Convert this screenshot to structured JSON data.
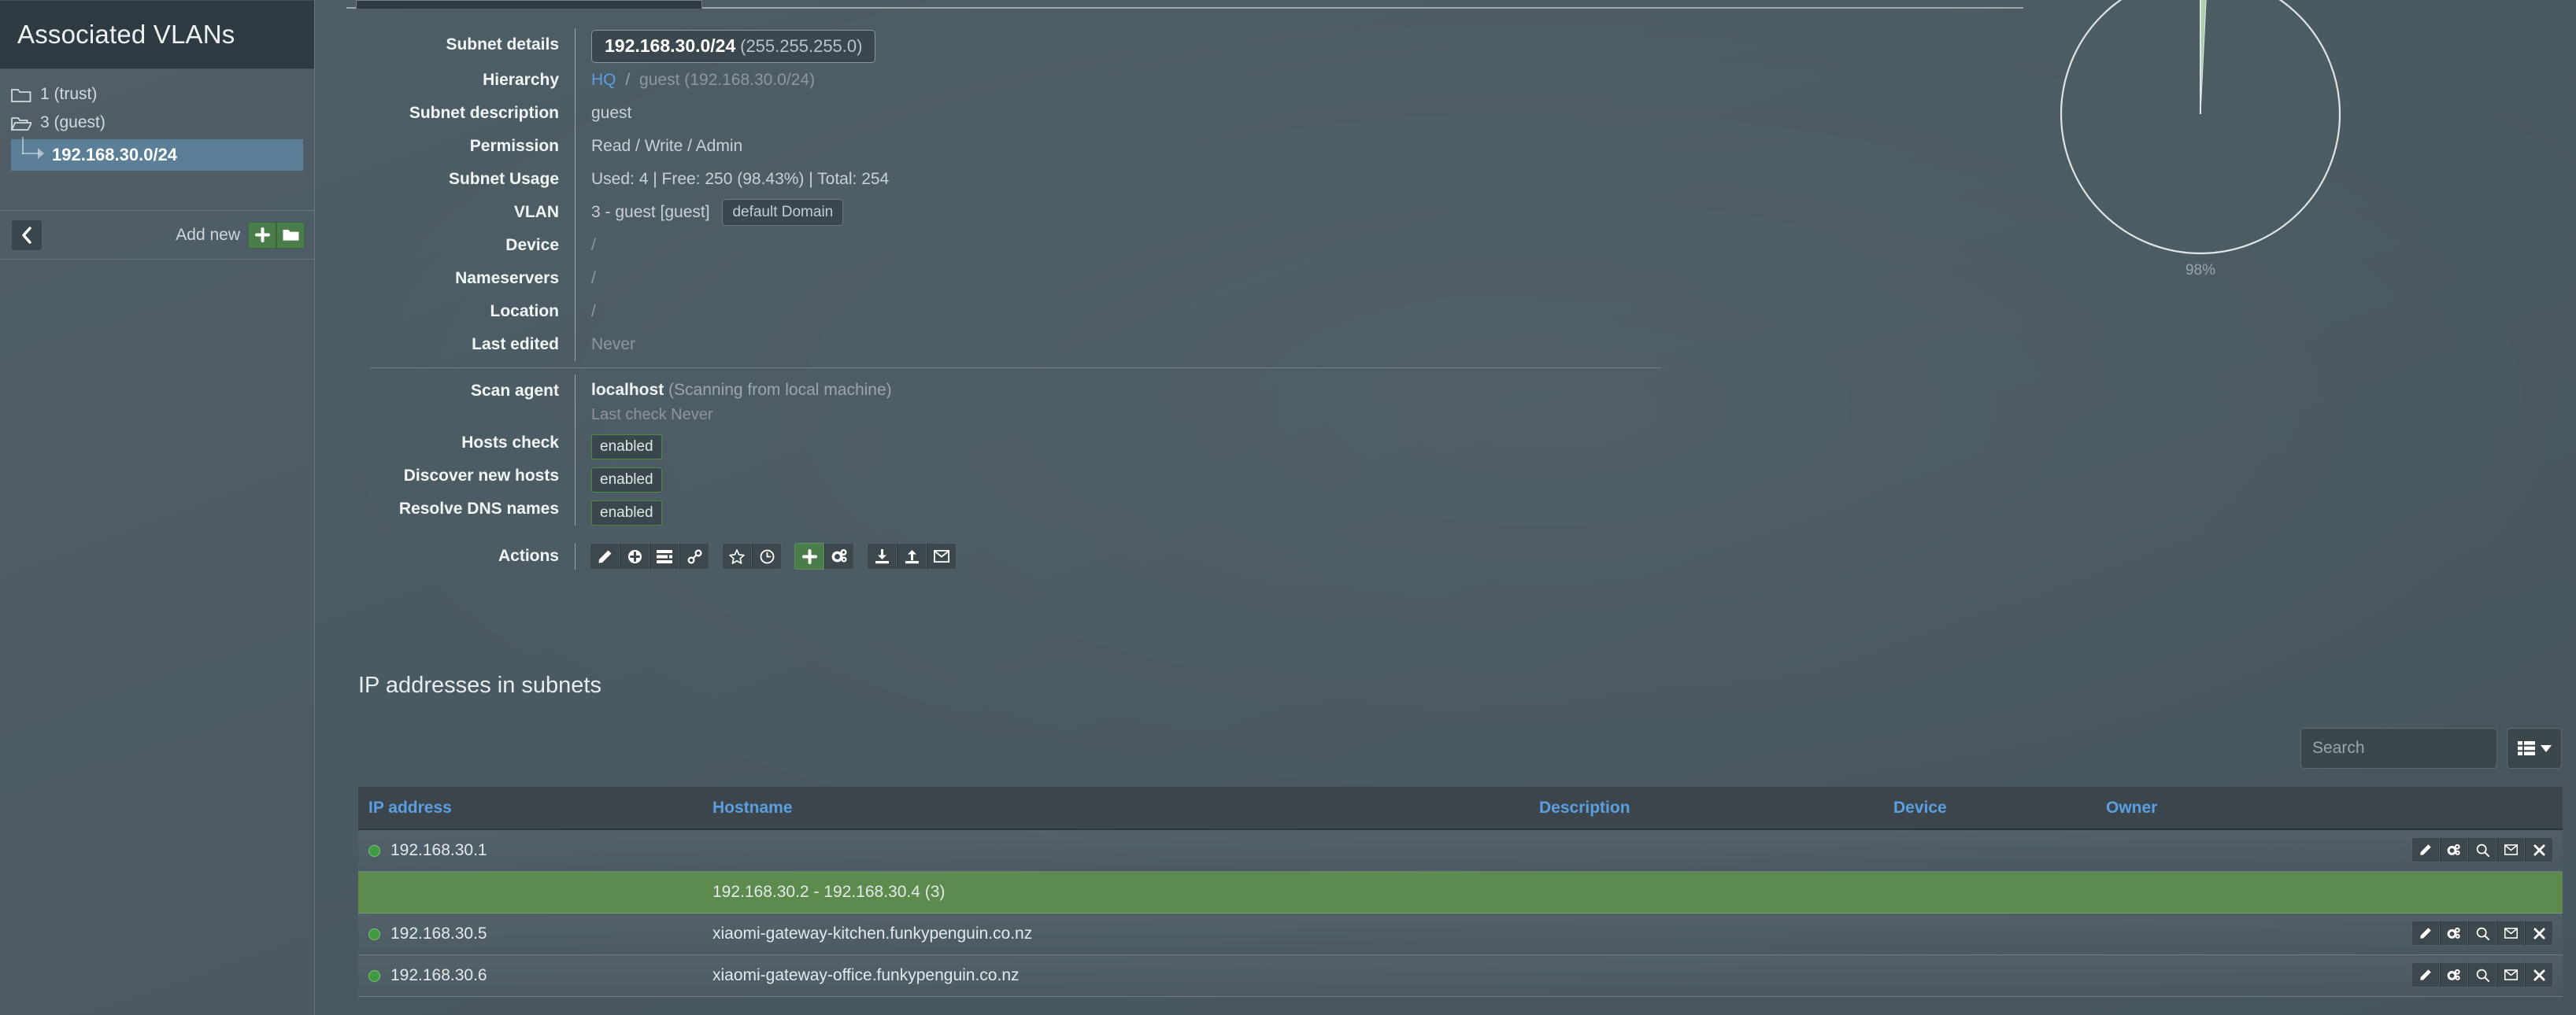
{
  "sidebar": {
    "title": "Associated VLANs",
    "items": [
      {
        "label": "1 (trust)",
        "icon": "folder-closed-icon",
        "type": "folder"
      },
      {
        "label": "3 (guest)",
        "icon": "folder-open-icon",
        "type": "folder-open"
      }
    ],
    "selected_subnet": "192.168.30.0/24",
    "add_new_label": "Add new",
    "back_icon": "chevron-left-icon",
    "add_plus_icon": "plus-icon",
    "add_folder_icon": "folder-icon"
  },
  "details": {
    "rows": [
      {
        "label": "Subnet details"
      },
      {
        "label": "Hierarchy"
      },
      {
        "label": "Subnet description"
      },
      {
        "label": "Permission"
      },
      {
        "label": "Subnet Usage"
      },
      {
        "label": "VLAN"
      },
      {
        "label": "Device"
      },
      {
        "label": "Nameservers"
      },
      {
        "label": "Location"
      },
      {
        "label": "Last edited"
      }
    ],
    "subnet_details": {
      "cidr": "192.168.30.0/24",
      "mask": "(255.255.255.0)"
    },
    "hierarchy": {
      "root": "HQ",
      "separator": "/",
      "child": "guest (192.168.30.0/24)"
    },
    "subnet_description": "guest",
    "permission": "Read / Write / Admin",
    "subnet_usage": "Used: 4 | Free: 250 (98.43%) | Total: 254",
    "vlan": {
      "text": "3 - guest [guest]",
      "domain": "default Domain"
    },
    "device": "/",
    "nameservers": "/",
    "location": "/",
    "last_edited": "Never"
  },
  "scan": {
    "scan_agent_label": "Scan agent",
    "agent_name": "localhost",
    "agent_note": "(Scanning from local machine)",
    "last_check": "Last check Never",
    "hosts_check_label": "Hosts check",
    "hosts_check_value": "enabled",
    "discover_label": "Discover new hosts",
    "discover_value": "enabled",
    "resolve_label": "Resolve DNS names",
    "resolve_value": "enabled"
  },
  "actions": {
    "label": "Actions",
    "groups": [
      [
        {
          "icon": "pencil-icon",
          "name": "edit-subnet-button"
        },
        {
          "icon": "plus-circle-icon",
          "name": "add-subnet-button"
        },
        {
          "icon": "list-icon",
          "name": "show-details-button"
        },
        {
          "icon": "link-icon",
          "name": "permalink-button"
        }
      ],
      [
        {
          "icon": "star-icon",
          "name": "favourite-button"
        },
        {
          "icon": "clock-icon",
          "name": "history-button"
        }
      ],
      [
        {
          "icon": "plus-icon",
          "name": "add-ip-button",
          "accent": "green"
        },
        {
          "icon": "gears-icon",
          "name": "scan-button"
        }
      ],
      [
        {
          "icon": "download-icon",
          "name": "import-button"
        },
        {
          "icon": "upload-icon",
          "name": "export-button"
        },
        {
          "icon": "envelope-icon",
          "name": "email-button"
        }
      ]
    ]
  },
  "ip_table": {
    "section_title": "IP addresses in subnets",
    "search_placeholder": "Search",
    "search_value": "",
    "view_toggle_icon": "table-view-icon",
    "columns": [
      "IP address",
      "Hostname",
      "Description",
      "Device",
      "Owner"
    ],
    "rows": [
      {
        "type": "host",
        "status": "online",
        "ip": "192.168.30.1",
        "hostname": "",
        "description": "",
        "device": "",
        "owner": "",
        "actions": [
          "pencil-icon",
          "gears-icon",
          "search-icon",
          "envelope-icon",
          "close-icon"
        ]
      },
      {
        "type": "free",
        "label": "192.168.30.2 - 192.168.30.4 (3)"
      },
      {
        "type": "host",
        "status": "online",
        "ip": "192.168.30.5",
        "hostname": "xiaomi-gateway-kitchen.funkypenguin.co.nz",
        "description": "",
        "device": "",
        "owner": "",
        "actions": [
          "pencil-icon",
          "gears-icon",
          "search-icon",
          "envelope-icon",
          "close-icon"
        ]
      },
      {
        "type": "host",
        "status": "online",
        "ip": "192.168.30.6",
        "hostname": "xiaomi-gateway-office.funkypenguin.co.nz",
        "description": "",
        "device": "",
        "owner": "",
        "actions": [
          "pencil-icon",
          "gears-icon",
          "search-icon",
          "envelope-icon",
          "close-icon"
        ]
      }
    ]
  },
  "chart_data": {
    "type": "pie",
    "title": "",
    "categories": [
      "Free",
      "Used"
    ],
    "values": [
      98.43,
      1.57
    ],
    "labels": [
      "98%",
      ""
    ],
    "colors": [
      "#4c5c63",
      "#a9ceab"
    ],
    "label_below": "98%",
    "legend": "none"
  },
  "colors": {
    "accent_blue": "#5a9fe0",
    "accent_green": "#4b7d4b",
    "free_row_green": "#5d8a4d",
    "selected_blue": "#5b7f96",
    "panel_dark": "#2f3b42",
    "page_bg": "#4c5c63"
  }
}
